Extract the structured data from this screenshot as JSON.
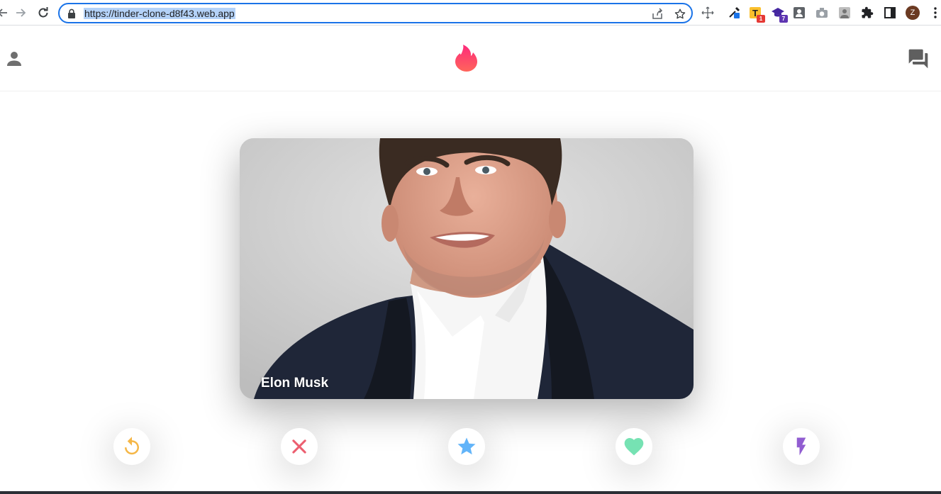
{
  "browser": {
    "url": "https://tinder-clone-d8f43.web.app",
    "extensions": [
      {
        "icon": "eyedropper-extension-icon"
      },
      {
        "icon": "t-extension-icon",
        "badge": "1",
        "badge_color": "#e53935"
      },
      {
        "icon": "graduation-cap-extension-icon",
        "badge": "7",
        "badge_color": "#5e35b1"
      },
      {
        "icon": "contact-card-extension-icon"
      },
      {
        "icon": "camera-extension-icon"
      },
      {
        "icon": "portrait-extension-icon"
      },
      {
        "icon": "puzzle-piece-icon"
      },
      {
        "icon": "side-panel-icon"
      }
    ],
    "profile_initial": "Z"
  },
  "header": {
    "left_icon": "person-icon",
    "logo_icon": "tinder-flame-icon",
    "right_icon": "forum-chat-icon",
    "brand_colors": [
      "#fd297b",
      "#ff655b"
    ]
  },
  "card": {
    "name": "Elon Musk"
  },
  "swipe_buttons": [
    {
      "name": "rewind",
      "icon": "replay-icon",
      "color": "#f5b748"
    },
    {
      "name": "nope",
      "icon": "close-icon",
      "color": "#ec5e6f"
    },
    {
      "name": "super-like",
      "icon": "star-icon",
      "color": "#62b4f9"
    },
    {
      "name": "like",
      "icon": "heart-icon",
      "color": "#76e2b3"
    },
    {
      "name": "boost",
      "icon": "flash-icon",
      "color": "#915dd1"
    }
  ]
}
